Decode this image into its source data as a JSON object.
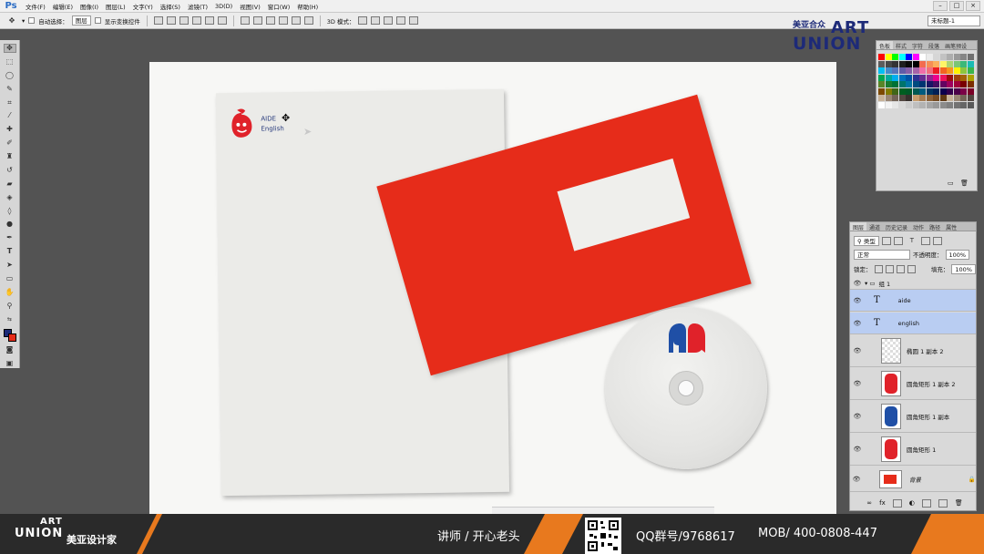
{
  "app": {
    "logo": "Ps"
  },
  "menu": [
    "文件(F)",
    "编辑(E)",
    "图像(I)",
    "图层(L)",
    "文字(Y)",
    "选择(S)",
    "滤镜(T)",
    "3D(D)",
    "视图(V)",
    "窗口(W)",
    "帮助(H)"
  ],
  "options": {
    "auto_select_label": "自动选择：",
    "auto_select_value": "图层",
    "show_transform_label": "显示变换控件",
    "mode_3d_label": "3D 模式："
  },
  "document_select": "未标题-1",
  "brand_top": {
    "cn": "美亚合众",
    "art": "ART",
    "union": "UNION"
  },
  "canvas": {
    "letterhead": {
      "line1": "AIDE",
      "line2": "English"
    }
  },
  "swatches": {
    "tabs": [
      "色板",
      "样式",
      "字符",
      "段落",
      "画笔预设"
    ],
    "colors": [
      "#ff0000",
      "#ffff00",
      "#00ff00",
      "#00ffff",
      "#0000ff",
      "#ff00ff",
      "#ffffff",
      "#ebebeb",
      "#d6d6d6",
      "#c2c2c2",
      "#adadad",
      "#999999",
      "#858585",
      "#707070",
      "#5c5c5c",
      "#474747",
      "#333333",
      "#1f1f1f",
      "#0a0a0a",
      "#000000",
      "#f26c4f",
      "#f68e55",
      "#fbaf5d",
      "#fff467",
      "#acd372",
      "#7cc576",
      "#3bb878",
      "#1abbb4",
      "#00bff3",
      "#438ccb",
      "#5574b9",
      "#605ca8",
      "#855fa8",
      "#a763a8",
      "#f06ea9",
      "#f26d7d",
      "#ed1c24",
      "#f26522",
      "#f7941d",
      "#fff200",
      "#8dc63f",
      "#39b54a",
      "#00a651",
      "#00a99d",
      "#00aeef",
      "#0072bc",
      "#0054a6",
      "#2e3192",
      "#662d91",
      "#92278f",
      "#ec008c",
      "#ed145b",
      "#9e0b0f",
      "#a0410d",
      "#a36209",
      "#aba000",
      "#598527",
      "#1a7b30",
      "#007236",
      "#00746b",
      "#0076a3",
      "#004b80",
      "#003471",
      "#1b1464",
      "#440e62",
      "#630460",
      "#9e005d",
      "#9e0039",
      "#790000",
      "#7b2e00",
      "#7d4900",
      "#827b00",
      "#406618",
      "#005e20",
      "#005826",
      "#005952",
      "#005b7f",
      "#003663",
      "#002157",
      "#0d004c",
      "#32004b",
      "#4b0049",
      "#7b0046",
      "#7a0026",
      "#c7b299",
      "#998675",
      "#736357",
      "#534741",
      "#37302d",
      "#c69c6d",
      "#a67c52",
      "#8c6239",
      "#754c24",
      "#603913",
      "#c7b299",
      "#998675",
      "#736357",
      "#534741",
      "#ffffff",
      "#f2f2f2",
      "#e6e6e6",
      "#d9d9d9",
      "#cccccc",
      "#bfbfbf",
      "#b3b3b3",
      "#a6a6a6",
      "#999999",
      "#8c8c8c",
      "#808080",
      "#737373",
      "#666666",
      "#595959"
    ]
  },
  "layers": {
    "tabs": [
      "图层",
      "通道",
      "历史记录",
      "动作",
      "路径",
      "属性"
    ],
    "filter_label": "类型",
    "blend_mode": "正常",
    "opacity_label": "不透明度：",
    "opacity_value": "100%",
    "lock_label": "锁定：",
    "fill_label": "填充：",
    "fill_value": "100%",
    "items": [
      {
        "name": "组 1",
        "kind": "group"
      },
      {
        "name": "aide",
        "kind": "text"
      },
      {
        "name": "english",
        "kind": "text"
      },
      {
        "name": "椭圆 1 副本 2",
        "kind": "shape"
      },
      {
        "name": "圆角矩形 1 副本 2",
        "kind": "shape"
      },
      {
        "name": "圆角矩形 1 副本",
        "kind": "shape"
      },
      {
        "name": "圆角矩形 1",
        "kind": "shape"
      },
      {
        "name": "背景",
        "kind": "background"
      }
    ]
  },
  "bottom": {
    "art": "ART",
    "union": "UNION",
    "cn": "美亚设计家",
    "lecturer": "讲师 / 开心老头",
    "qq": "QQ群号/9768617",
    "mob": "MOB/ 400-0808-447"
  }
}
